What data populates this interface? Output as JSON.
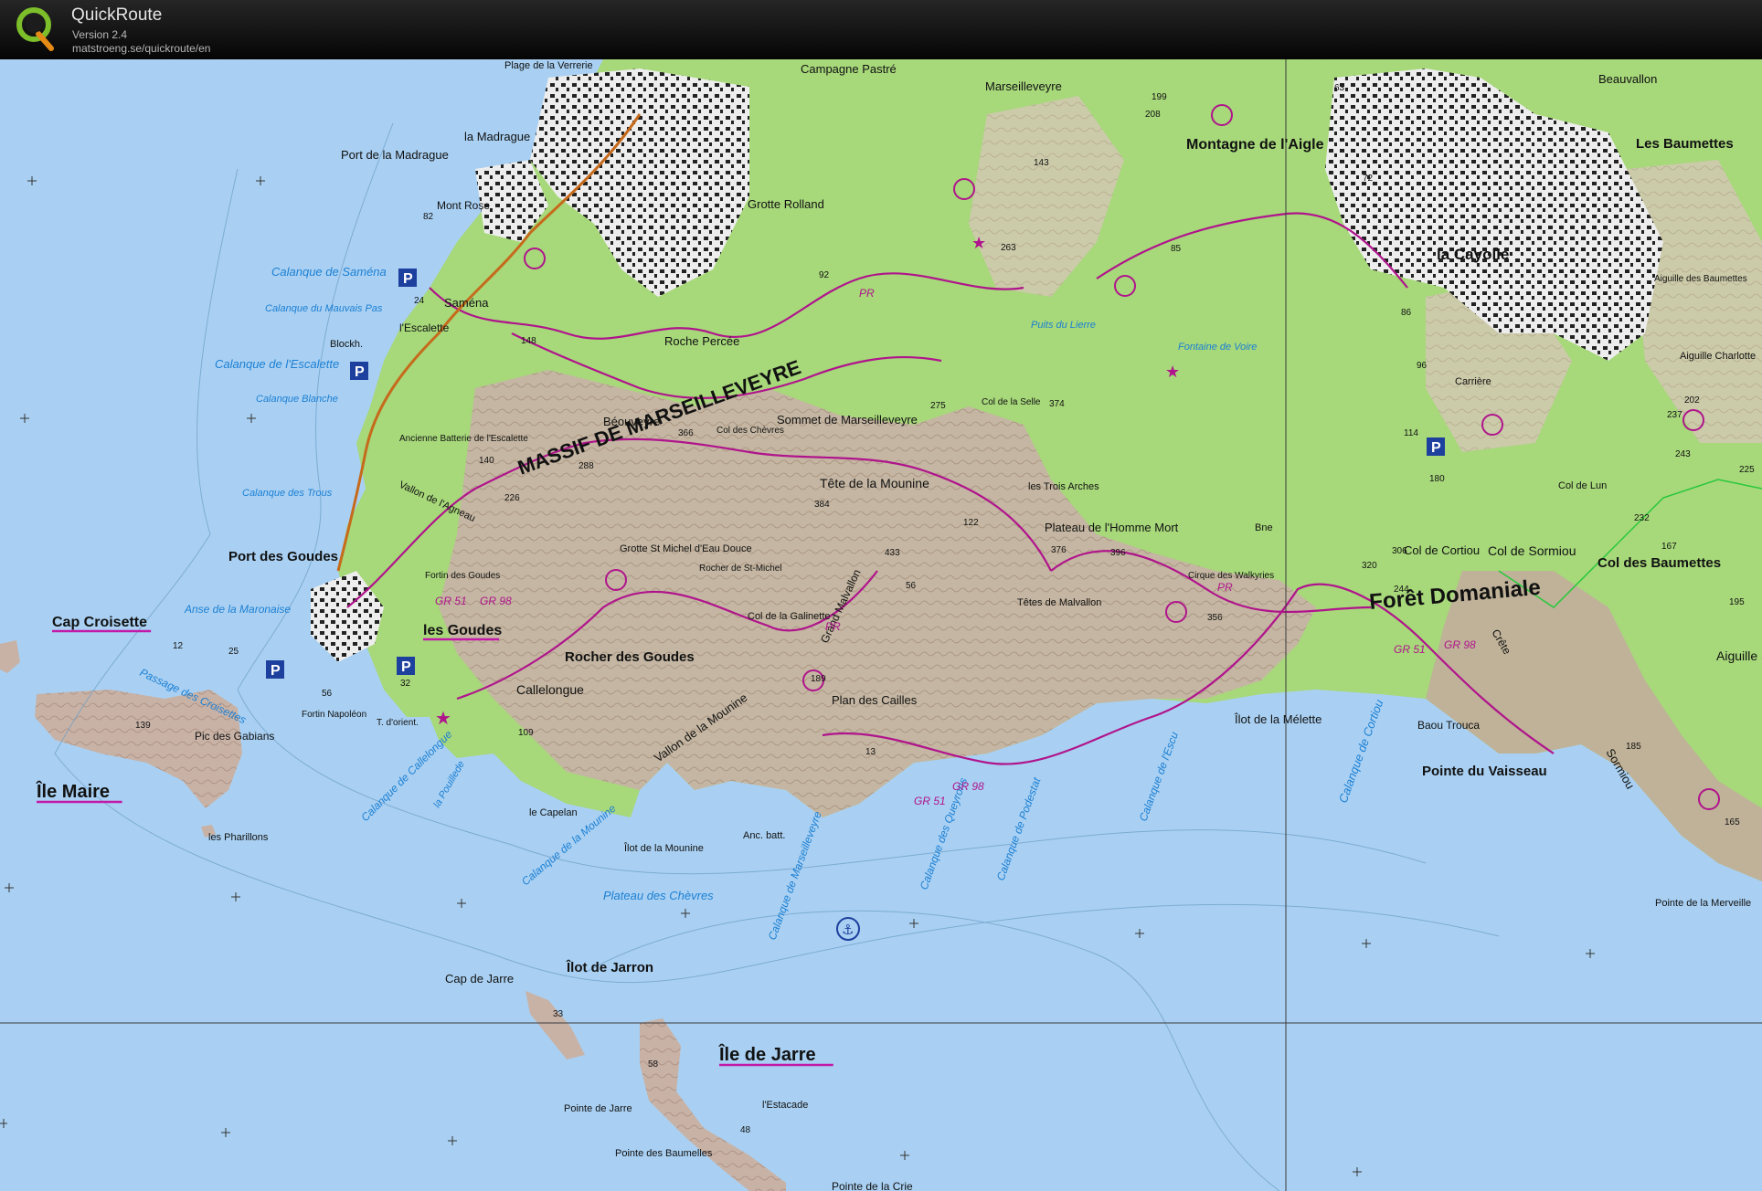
{
  "app": {
    "title": "QuickRoute",
    "version": "Version 2.4",
    "url": "matstroeng.se/quickroute/en"
  },
  "colors": {
    "sea": "#a9d0f2",
    "land_vegetation": "#a7d87a",
    "rock": "#c8b2a6",
    "urban": "#ececec",
    "trail": "#b0148c",
    "label_blue": "#1b7fd4",
    "parking": "#1d3f9e"
  },
  "map": {
    "place_labels": [
      "Plage de la Verrerie",
      "la Madrague",
      "Port de la Madrague",
      "Mont Rose",
      "Calanque de Saména",
      "Calanque du Mauvais Pas",
      "Saména",
      "l'Escalette",
      "Blockh.",
      "Calanque de l'Escalette",
      "Calanque Blanche",
      "Ancienne Batterie de l'Escalette",
      "Vallon de l'Agneau",
      "Calanque des Trous",
      "Port des Goudes",
      "Fortin des Goudes",
      "les Goudes",
      "Anse de la Maronaise",
      "Cap Croisette",
      "Passage des Croisettes",
      "Fortin Napoléon",
      "Pic des Gabians",
      "Île Maire",
      "les Pharillons",
      "T. d'orient.",
      "Callelongue",
      "Calanque de Callelongue",
      "la Pouillede",
      "le Capelan",
      "Calanque de la Mounine",
      "Îlot de la Mounine",
      "Anc. batt.",
      "Plateau des Chèvres",
      "Calanque de Marseilleveyre",
      "Îlot de Jarron",
      "Cap de Jarre",
      "Île de Jarre",
      "Pointe de Jarre",
      "l'Estacade",
      "Pointe des Baumelles",
      "Pointe de la Crie",
      "Campagne Pastré",
      "Marseilleveyre",
      "Grotte Rolland",
      "Roche Percée",
      "MASSIF DE MARSEILLEVEYRE",
      "Béouveyre",
      "Col des Chèvres",
      "Sommet de Marseilleveyre",
      "Tête de la Mounine",
      "Grotte St Michel d'Eau Douce",
      "Rocher de St-Michel",
      "Col de la Galinette",
      "Grand Malvallon",
      "Rocher des Goudes",
      "Vallon de la Mounine",
      "Plan des Cailles",
      "Têtes de Malvallon",
      "Plateau de l'Homme Mort",
      "les Trois Arches",
      "Cirque des Walkyries",
      "Col de la Selle",
      "Montagne de l'Aigle",
      "Fontaine de Voire",
      "Puits du Lierre",
      "la Cayolle",
      "Carrière",
      "Les Baumettes",
      "Beauvallon",
      "Col de Cortiou",
      "Forêt Domaniale",
      "Col de Sormiou",
      "Col des Baumettes",
      "Aiguille des Baumettes",
      "Aiguille Charlotte",
      "Îlot de la Mélette",
      "Baou Trouca",
      "Pointe du Vaisseau",
      "Calanque de Cortiou",
      "Calanque de l'Escu",
      "Calanque de Podestat",
      "Calanque des Queyrons",
      "Sormiou",
      "Aiguille Sormiou",
      "Pointe de la Merveille",
      "Crête",
      "Col de Lun",
      "Bne"
    ],
    "route_codes": [
      "GR 51",
      "GR 98",
      "PR"
    ],
    "underlined_labels": [
      "Cap Croisette",
      "Île Maire",
      "les Goudes",
      "Île de Jarre",
      "MARSEILLEVEYRE"
    ],
    "spot_heights": [
      "82",
      "24",
      "148",
      "140",
      "226",
      "288",
      "366",
      "384",
      "433",
      "356",
      "263",
      "143",
      "208",
      "199",
      "92",
      "85",
      "122",
      "374",
      "275",
      "396",
      "376",
      "306",
      "320",
      "244",
      "189",
      "109",
      "56",
      "13",
      "33",
      "58",
      "48",
      "139",
      "56",
      "32",
      "25",
      "12",
      "72",
      "63",
      "86",
      "96",
      "114",
      "180",
      "225",
      "237",
      "243",
      "232",
      "195",
      "167",
      "202",
      "165",
      "185"
    ]
  }
}
